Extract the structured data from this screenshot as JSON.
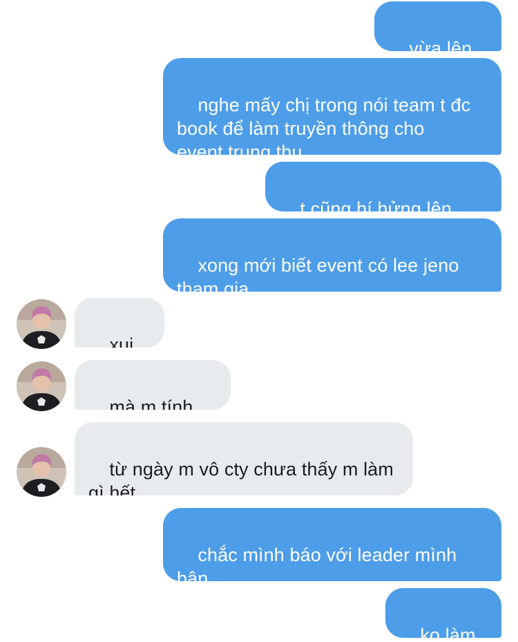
{
  "messages": [
    {
      "id": "m1",
      "from": "me",
      "text": "vừa lên cty"
    },
    {
      "id": "m2",
      "from": "me",
      "text": "nghe mấy chị trong nói team t đc\nbook để làm truyền thông cho\nevent trung thu"
    },
    {
      "id": "m3",
      "from": "me",
      "text": "t cũng hí hửng lên plan"
    },
    {
      "id": "m4",
      "from": "me",
      "text": "xong mới biết event có lee jeno\ntham gia"
    },
    {
      "id": "m5",
      "from": "them",
      "text": "xui thế"
    },
    {
      "id": "m6",
      "from": "them",
      "text": "mà m tính sao"
    },
    {
      "id": "m7",
      "from": "them",
      "text": "từ ngày m vô cty chưa thấy m làm\ngì hết"
    },
    {
      "id": "m8",
      "from": "me",
      "text": "chắc mình báo với leader mình\nbận"
    },
    {
      "id": "m9",
      "from": "me",
      "text": "ko làm đc"
    }
  ],
  "colors": {
    "sent_bubble": "#4d9de8",
    "received_bubble": "#e8ebee",
    "sent_text": "#ffffff",
    "received_text": "#1a1d21"
  },
  "icons": {
    "avatar": "contact-avatar-photo"
  }
}
